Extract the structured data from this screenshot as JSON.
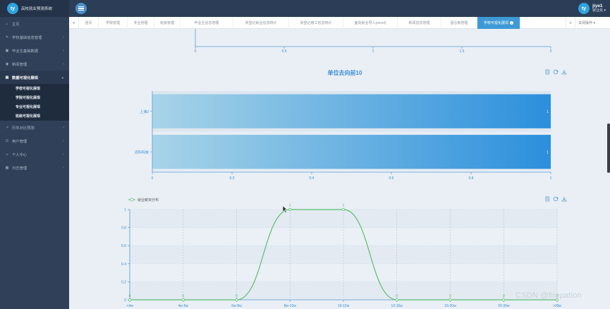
{
  "app": {
    "logo_glyph": "ty",
    "title": "高校就业预测系统"
  },
  "user": {
    "avatar_glyph": "ty",
    "name": "jiye1",
    "role": "就业处 ▾"
  },
  "sidebar": {
    "items": [
      {
        "icon": "home-icon",
        "label": "主页"
      },
      {
        "icon": "school-icon",
        "label": "学校基础信息管理"
      },
      {
        "icon": "book-icon",
        "label": "毕业生基础数据"
      },
      {
        "icon": "eye-icon",
        "label": "新闻管理"
      },
      {
        "icon": "chart-icon",
        "label": "数据可视化展现"
      },
      {
        "icon": "forecast-icon",
        "label": "历年对比预测"
      },
      {
        "icon": "users-icon",
        "label": "用户管理"
      },
      {
        "icon": "user-icon",
        "label": "个人中心"
      },
      {
        "icon": "log-icon",
        "label": "日志管理"
      }
    ],
    "subitems": [
      "学校可视化展现",
      "学院可视化展现",
      "专业可视化展现",
      "班级可视化展现"
    ]
  },
  "tabs": {
    "prev_glyph": "«",
    "next_glyph": "»",
    "close_glyph": "×",
    "items": [
      "首页",
      "学院管理",
      "专业管理",
      "班级管理",
      "毕业生信息管理",
      "未登记就业信息统计",
      "未登记用工信息统计",
      "面向就业导入(excel)",
      "新闻信息管理",
      "留言板管理",
      "学校可视化展现"
    ],
    "active_index": 10,
    "close_ops": "关闭操作 ▾"
  },
  "chart_top_partial": {
    "x_ticks": [
      "0",
      "0.5",
      "1",
      "1.5",
      "2"
    ]
  },
  "chart_bar": {
    "toolbar": [
      "document-icon",
      "refresh-icon",
      "download-icon"
    ],
    "chart_data": {
      "type": "bar",
      "orientation": "horizontal",
      "title": "单位去向前10",
      "categories": [
        "迈科科技",
        "上海2"
      ],
      "values": [
        1,
        1
      ],
      "xlim": [
        0,
        1
      ],
      "x_ticks": [
        "0",
        "0.2",
        "0.4",
        "0.6",
        "0.8",
        "1"
      ],
      "data_labels": [
        "1",
        "1"
      ],
      "colors": {
        "bar_start": "#a8d4e8",
        "bar_end": "#2b8fdc"
      }
    }
  },
  "chart_line": {
    "toolbar": [
      "document-icon",
      "refresh-icon",
      "download-icon"
    ],
    "chart_data": {
      "type": "area",
      "legend": [
        "就业薪资分布"
      ],
      "legend_position": "top-left",
      "categories": [
        "<4w",
        "4w-6w",
        "6w-8w",
        "8w-10w",
        "10-12w",
        "12-15w",
        "15-20w",
        "20-30w",
        ">30w"
      ],
      "series": [
        {
          "name": "就业薪资分布",
          "values": [
            0,
            0,
            0,
            1,
            1,
            0,
            0,
            0,
            0
          ]
        }
      ],
      "data_labels": [
        "0",
        "0",
        "0",
        "1",
        "1",
        "0",
        "0",
        "0",
        "0"
      ],
      "ylim": [
        0,
        1
      ],
      "y_ticks": [
        "0",
        "0.2",
        "0.4",
        "0.6",
        "0.8",
        "1"
      ],
      "smooth": true,
      "color": "#5cbf6e"
    }
  },
  "watermark": "CSDN @firepation"
}
